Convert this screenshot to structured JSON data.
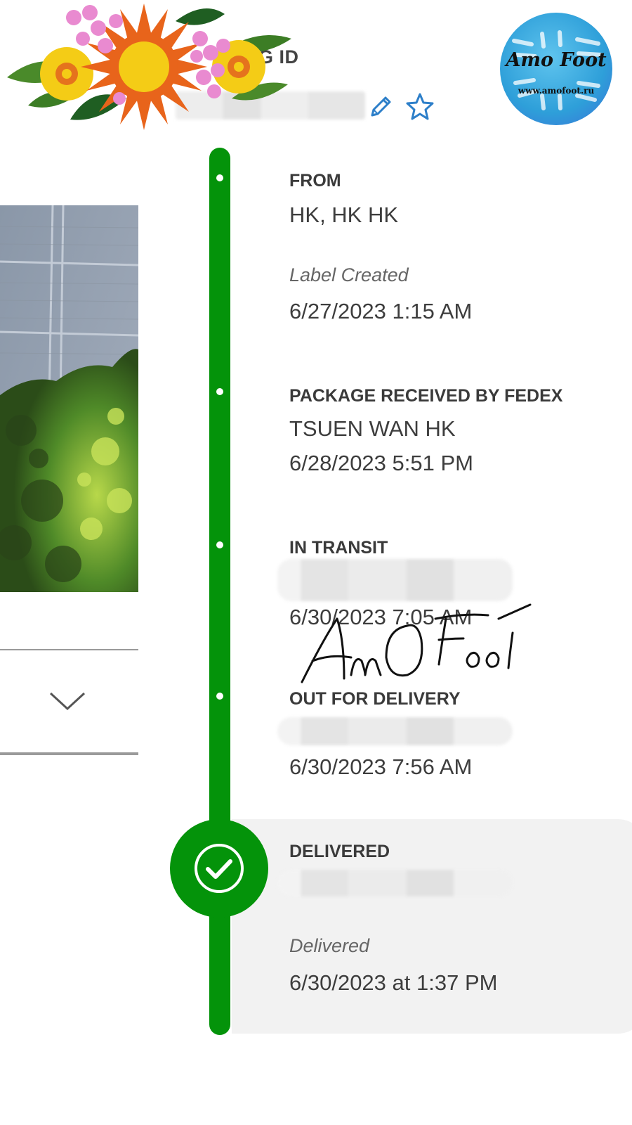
{
  "header": {
    "tracking_label": "ING ID",
    "edit_icon": "pencil-icon",
    "star_icon": "star-outline-icon"
  },
  "logo": {
    "title": "Amo Foot",
    "url": "www.amofoot.ru"
  },
  "watermark_signature": "AmO Foot",
  "dropdown": {
    "icon": "chevron-down-icon"
  },
  "timeline": {
    "accent_color": "#04930a",
    "events": [
      {
        "title": "FROM",
        "location": "HK, HK HK",
        "status": "Label Created",
        "datetime": "6/27/2023 1:15 AM"
      },
      {
        "title": "PACKAGE RECEIVED BY FEDEX",
        "location": "TSUEN WAN HK",
        "datetime": "6/28/2023 5:51 PM"
      },
      {
        "title": "IN TRANSIT",
        "datetime": "6/30/2023 7:05 AM"
      },
      {
        "title": "OUT FOR DELIVERY",
        "datetime": "6/30/2023 7:56 AM"
      },
      {
        "title": "DELIVERED",
        "status": "Delivered",
        "datetime": "6/30/2023 at 1:37 PM"
      }
    ]
  }
}
